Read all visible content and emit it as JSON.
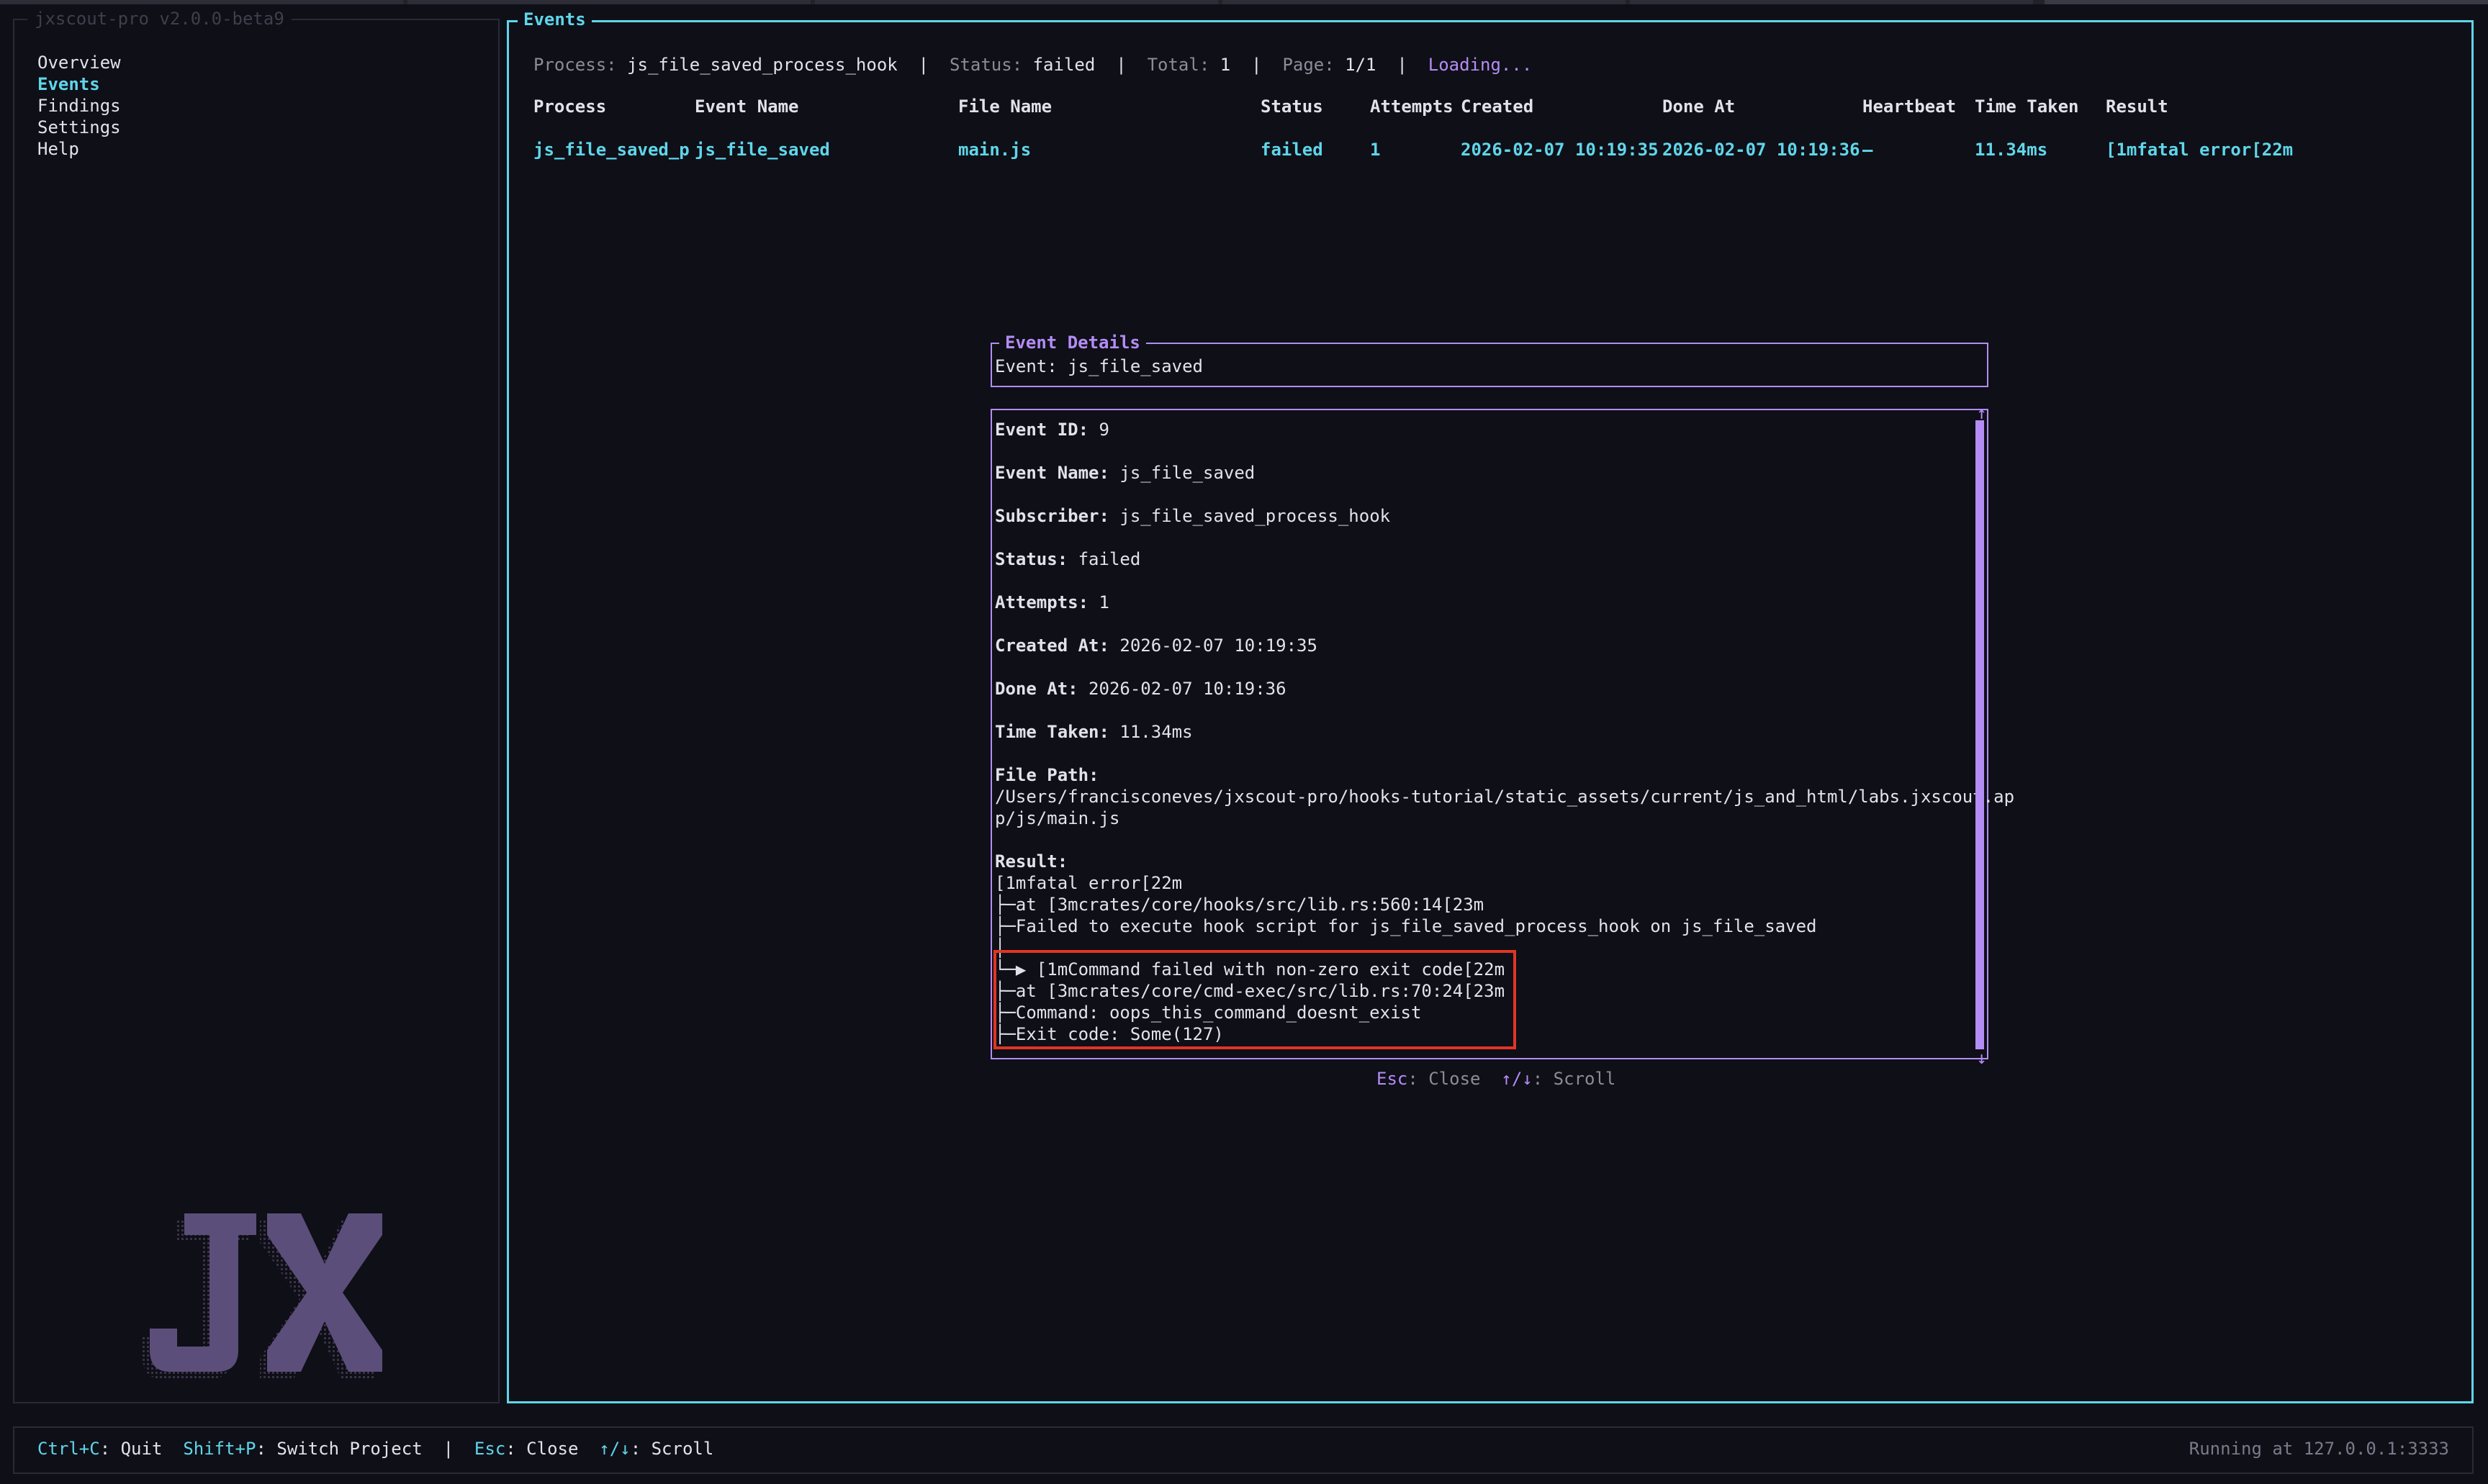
{
  "app": {
    "title": "jxscout-pro v2.0.0-beta9"
  },
  "sidebar": {
    "items": [
      {
        "label": "Overview",
        "active": false
      },
      {
        "label": "Events",
        "active": true
      },
      {
        "label": "Findings",
        "active": false
      },
      {
        "label": "Settings",
        "active": false
      },
      {
        "label": "Help",
        "active": false
      }
    ],
    "logo_text": "JX"
  },
  "events_panel": {
    "title": "Events",
    "info": {
      "process_label": "Process:",
      "process_value": "js_file_saved_process_hook",
      "status_label": "Status:",
      "status_value": "failed",
      "total_label": "Total:",
      "total_value": "1",
      "page_label": "Page:",
      "page_value": "1/1",
      "loading": "Loading...",
      "separator": "|"
    },
    "columns": [
      "Process",
      "Event Name",
      "File Name",
      "Status",
      "Attempts",
      "Created",
      "Done At",
      "Heartbeat",
      "Time Taken",
      "Result"
    ],
    "rows": [
      [
        "js_file_saved_p",
        "js_file_saved",
        "main.js",
        "failed",
        "1",
        "2026-02-07 10:19:35",
        "2026-02-07 10:19:36",
        "–",
        "11.34ms",
        "[1mfatal error[22m"
      ]
    ]
  },
  "modal": {
    "title": "Event Details",
    "event_line": "Event: js_file_saved",
    "fields": {
      "event_id_label": "Event ID:",
      "event_id": "9",
      "event_name_label": "Event Name:",
      "event_name": "js_file_saved",
      "subscriber_label": "Subscriber:",
      "subscriber": "js_file_saved_process_hook",
      "status_label": "Status:",
      "status": "failed",
      "attempts_label": "Attempts:",
      "attempts": "1",
      "created_label": "Created At:",
      "created": "2026-02-07 10:19:35",
      "done_label": "Done At:",
      "done": "2026-02-07 10:19:36",
      "time_label": "Time Taken:",
      "time": "11.34ms",
      "file_path_label": "File Path:",
      "file_path_line1": "/Users/francisconeves/jxscout-pro/hooks-tutorial/static_assets/current/js_and_html/labs.jxscout.ap",
      "file_path_line2": "p/js/main.js",
      "result_label": "Result:",
      "result_lines": [
        "[1mfatal error[22m",
        "├─at [3mcrates/core/hooks/src/lib.rs:560:14[23m",
        "├─Failed to execute hook script for js_file_saved_process_hook on js_file_saved",
        "│",
        "└─▶ [1mCommand failed with non-zero exit code[22m",
        "├─at [3mcrates/core/cmd-exec/src/lib.rs:70:24[23m",
        "├─Command: oops_this_command_doesnt_exist",
        "├─Exit code: Some(127)"
      ]
    },
    "scroll_up": "↑",
    "scroll_down": "↓",
    "scroll_position": 1.0,
    "footer": {
      "esc_key": "Esc",
      "esc_action": ": Close",
      "scroll_key": "↑/↓",
      "scroll_action": ": Scroll"
    }
  },
  "statusbar": {
    "keys": [
      {
        "key": "Ctrl+C",
        "action": ": Quit"
      },
      {
        "key": "Shift+P",
        "action": ": Switch Project"
      },
      {
        "key": "Esc",
        "action": ": Close"
      },
      {
        "key": "↑/↓",
        "action": ": Scroll"
      }
    ],
    "separator": "|",
    "running": "Running at 127.0.0.1:3333"
  },
  "colors": {
    "accent_cyan": "#5fd6ea",
    "accent_purple": "#b48cf5",
    "highlight_red": "#e03524",
    "background": "#0f0f17"
  }
}
